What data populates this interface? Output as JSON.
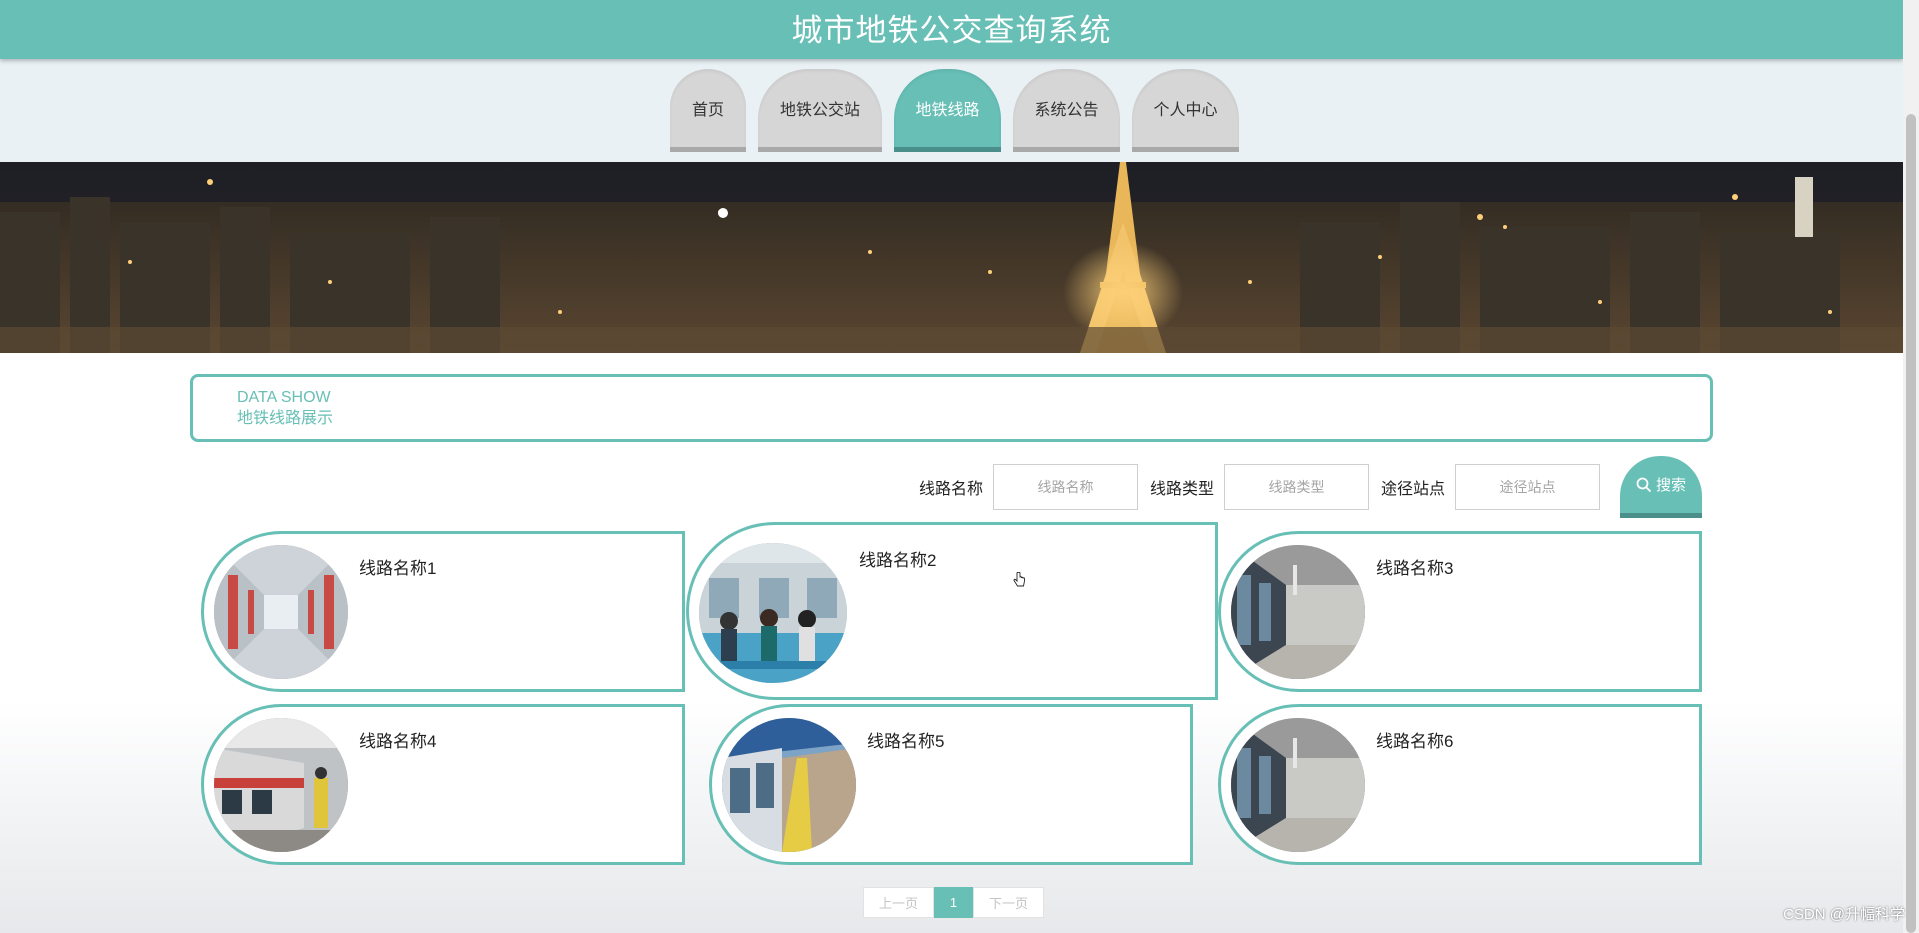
{
  "header": {
    "title": "城市地铁公交查询系统"
  },
  "nav": {
    "tabs": [
      {
        "label": "首页",
        "active": false
      },
      {
        "label": "地铁公交站",
        "active": false
      },
      {
        "label": "地铁线路",
        "active": true
      },
      {
        "label": "系统公告",
        "active": false
      },
      {
        "label": "个人中心",
        "active": false
      }
    ]
  },
  "section": {
    "en_title": "DATA SHOW",
    "cn_title": "地铁线路展示"
  },
  "search": {
    "fields": [
      {
        "label": "线路名称",
        "placeholder": "线路名称"
      },
      {
        "label": "线路类型",
        "placeholder": "线路类型"
      },
      {
        "label": "途径站点",
        "placeholder": "途径站点"
      }
    ],
    "button_label": "搜索",
    "button_icon": "search-icon"
  },
  "cards": [
    {
      "name": "线路名称1",
      "image": "train-interior"
    },
    {
      "name": "线路名称2",
      "image": "platform-crowd"
    },
    {
      "name": "线路名称3",
      "image": "platform-doors"
    },
    {
      "name": "线路名称4",
      "image": "platform-train"
    },
    {
      "name": "线路名称5",
      "image": "platform-outdoor"
    },
    {
      "name": "线路名称6",
      "image": "platform-doors"
    }
  ],
  "pagination": {
    "prev": "上一页",
    "current": "1",
    "next": "下一页"
  },
  "watermark": "CSDN @升幅科学",
  "colors": {
    "accent": "#67bfb6",
    "accent_dark": "#4a8f8a",
    "tab_inactive": "#d6d6d6",
    "nav_bg": "#e9f1f5"
  }
}
